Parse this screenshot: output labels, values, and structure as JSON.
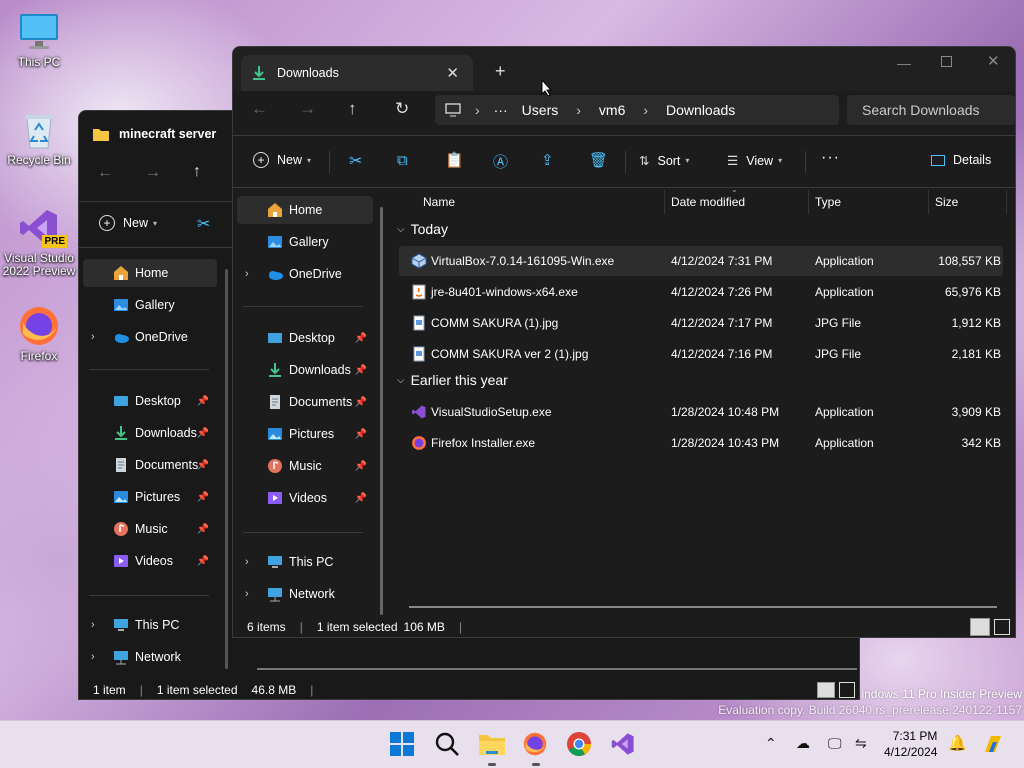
{
  "desktop": {
    "icons": [
      {
        "label": "This PC",
        "icon": "monitor-icon"
      },
      {
        "label": "Recycle Bin",
        "icon": "recycle-bin-icon"
      },
      {
        "label": "Visual Studio 2022 Preview",
        "icon": "visual-studio-icon",
        "badge": "PRE"
      },
      {
        "label": "Firefox",
        "icon": "firefox-icon"
      }
    ],
    "watermark_line1": "indows 11 Pro Insider Preview",
    "watermark_line2": "Evaluation copy. Build 26040.rs_prerelease.240122-1157"
  },
  "back_window": {
    "tab_title": "minecraft server",
    "new_label": "New",
    "nav": [
      {
        "label": "Home",
        "icon": "home-icon",
        "selected": true
      },
      {
        "label": "Gallery",
        "icon": "gallery-icon"
      },
      {
        "label": "OneDrive",
        "icon": "onedrive-icon",
        "expandable": true
      },
      {
        "label": "Desktop",
        "icon": "desktop-folder-icon",
        "pinned": true
      },
      {
        "label": "Downloads",
        "icon": "downloads-icon",
        "pinned": true
      },
      {
        "label": "Documents",
        "icon": "documents-icon",
        "pinned": true
      },
      {
        "label": "Pictures",
        "icon": "pictures-icon",
        "pinned": true
      },
      {
        "label": "Music",
        "icon": "music-icon",
        "pinned": true
      },
      {
        "label": "Videos",
        "icon": "videos-icon",
        "pinned": true
      },
      {
        "label": "This PC",
        "icon": "this-pc-icon",
        "expandable": true
      },
      {
        "label": "Network",
        "icon": "network-icon",
        "expandable": true
      }
    ],
    "status": {
      "items": "1 item",
      "selected": "1 item selected",
      "size": "46.8 MB"
    }
  },
  "front_window": {
    "tab_title": "Downloads",
    "breadcrumb": [
      "Users",
      "vm6",
      "Downloads"
    ],
    "search_placeholder": "Search Downloads",
    "toolbar": {
      "new": "New",
      "sort": "Sort",
      "view": "View",
      "details": "Details"
    },
    "nav": [
      {
        "label": "Home",
        "icon": "home-icon",
        "selected": true
      },
      {
        "label": "Gallery",
        "icon": "gallery-icon"
      },
      {
        "label": "OneDrive",
        "icon": "onedrive-icon",
        "expandable": true
      },
      {
        "label": "Desktop",
        "icon": "desktop-folder-icon",
        "pinned": true
      },
      {
        "label": "Downloads",
        "icon": "downloads-icon",
        "pinned": true
      },
      {
        "label": "Documents",
        "icon": "documents-icon",
        "pinned": true
      },
      {
        "label": "Pictures",
        "icon": "pictures-icon",
        "pinned": true
      },
      {
        "label": "Music",
        "icon": "music-icon",
        "pinned": true
      },
      {
        "label": "Videos",
        "icon": "videos-icon",
        "pinned": true
      },
      {
        "label": "This PC",
        "icon": "this-pc-icon",
        "expandable": true
      },
      {
        "label": "Network",
        "icon": "network-icon",
        "expandable": true
      }
    ],
    "columns": {
      "name": "Name",
      "date": "Date modified",
      "type": "Type",
      "size": "Size"
    },
    "groups": [
      {
        "title": "Today",
        "files": [
          {
            "name": "VirtualBox-7.0.14-161095-Win.exe",
            "date": "4/12/2024 7:31 PM",
            "type": "Application",
            "size": "108,557 KB",
            "icon": "virtualbox-icon",
            "selected": true
          },
          {
            "name": "jre-8u401-windows-x64.exe",
            "date": "4/12/2024 7:26 PM",
            "type": "Application",
            "size": "65,976 KB",
            "icon": "java-installer-icon"
          },
          {
            "name": "COMM SAKURA  (1).jpg",
            "date": "4/12/2024 7:17 PM",
            "type": "JPG File",
            "size": "1,912 KB",
            "icon": "image-file-icon"
          },
          {
            "name": "COMM SAKURA ver 2 (1).jpg",
            "date": "4/12/2024 7:16 PM",
            "type": "JPG File",
            "size": "2,181 KB",
            "icon": "image-file-icon"
          }
        ]
      },
      {
        "title": "Earlier this year",
        "files": [
          {
            "name": "VisualStudioSetup.exe",
            "date": "1/28/2024 10:48 PM",
            "type": "Application",
            "size": "3,909 KB",
            "icon": "visual-studio-icon"
          },
          {
            "name": "Firefox Installer.exe",
            "date": "1/28/2024 10:43 PM",
            "type": "Application",
            "size": "342 KB",
            "icon": "firefox-icon"
          }
        ]
      }
    ],
    "status": {
      "items": "6 items",
      "selected": "1 item selected",
      "size": "106 MB"
    }
  },
  "taskbar": {
    "time": "7:31 PM",
    "date": "4/12/2024",
    "apps": [
      "start-icon",
      "search-icon",
      "file-explorer-icon",
      "firefox-icon",
      "chrome-icon",
      "visual-studio-icon"
    ]
  },
  "colors": {
    "accent": "#4cc2ff",
    "window_bg": "#1c1c1c",
    "selected_bg": "#2d2d2d"
  }
}
